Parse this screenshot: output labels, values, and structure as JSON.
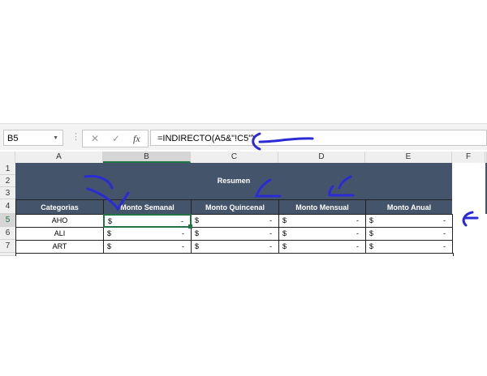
{
  "name_box": "B5",
  "formula": "=INDIRECTO(A5&\"!C5\")",
  "formula_buttons": {
    "cancel": "✕",
    "enter": "✓",
    "fx": "fx"
  },
  "columns": [
    "A",
    "B",
    "C",
    "D",
    "E",
    "F"
  ],
  "rows": [
    "1",
    "2",
    "3",
    "4",
    "5",
    "6",
    "7"
  ],
  "title": "Resumen",
  "headers": [
    "Categorias",
    "Monto Semanal",
    "Monto Quincenal",
    "Monto Mensual",
    "Monto Anual"
  ],
  "data": [
    {
      "cat": "AHO",
      "cur": "$",
      "val": "-"
    },
    {
      "cat": "ALI",
      "cur": "$",
      "val": "-"
    },
    {
      "cat": "ART",
      "cur": "$",
      "val": "-"
    }
  ],
  "colors": {
    "header": "#44546a",
    "selection": "#217346",
    "annotation": "#2b2bd6"
  }
}
